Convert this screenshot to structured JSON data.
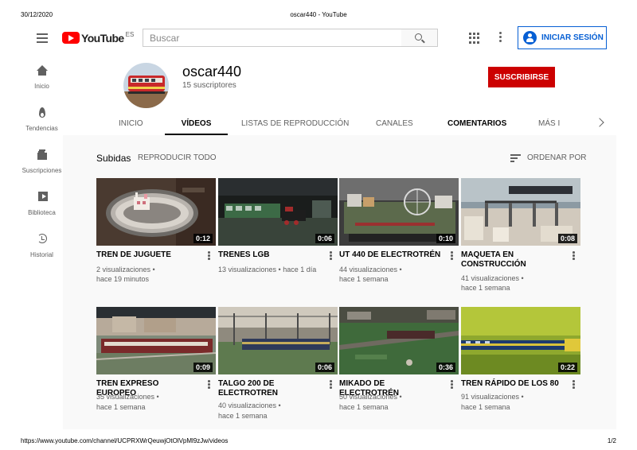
{
  "print": {
    "date": "30/12/2020",
    "title": "oscar440 - YouTube",
    "url": "https://www.youtube.com/channel/UCPRXWrQeuwjOtOlVpMl9zJw/videos",
    "page": "1/2"
  },
  "topbar": {
    "logo_text": "YouTube",
    "country_code": "ES",
    "search_placeholder": "Buscar",
    "signin_label": "INICIAR SESIÓN"
  },
  "sidebar": {
    "items": [
      {
        "label": "Inicio",
        "icon": "home-icon"
      },
      {
        "label": "Tendencias",
        "icon": "flame-icon"
      },
      {
        "label": "Suscripciones",
        "icon": "subscriptions-icon"
      },
      {
        "label": "Biblioteca",
        "icon": "library-icon"
      },
      {
        "label": "Historial",
        "icon": "history-icon"
      }
    ]
  },
  "channel": {
    "name": "oscar440",
    "subscribers": "15 suscriptores",
    "subscribe_label": "SUSCRIBIRSE",
    "tabs": [
      "INICIO",
      "VÍDEOS",
      "LISTAS DE REPRODUCCIÓN",
      "CANALES",
      "COMENTARIOS",
      "MÁS I"
    ],
    "active_tab": "VÍDEOS"
  },
  "section": {
    "title": "Subidas",
    "play_all": "REPRODUCIR TODO",
    "sort_label": "ORDENAR POR"
  },
  "videos": [
    {
      "title": "TREN DE JUGUETE",
      "views": "2 visualizaciones •",
      "age": "hace 19 minutos",
      "duration": "0:12"
    },
    {
      "title": "TRENES LGB",
      "views": "13 visualizaciones • hace 1 día",
      "age": "",
      "duration": "0:06"
    },
    {
      "title": "UT 440 DE ELECTROTRÉN",
      "views": "44 visualizaciones •",
      "age": "hace 1 semana",
      "duration": "0:10"
    },
    {
      "title": "MAQUETA EN CONSTRUCCIÓN",
      "views": "41 visualizaciones •",
      "age": "hace 1 semana",
      "duration": "0:08"
    },
    {
      "title": "TREN EXPRESO EUROPEO",
      "views": "35 visualizaciones •",
      "age": "hace 1 semana",
      "duration": "0:09"
    },
    {
      "title": "TALGO 200 DE ELECTROTREN",
      "views": "40 visualizaciones •",
      "age": "hace 1 semana",
      "duration": "0:06"
    },
    {
      "title": "MIKADO DE ELECTROTRÉN",
      "views": "50 visualizaciones •",
      "age": "hace 1 semana",
      "duration": "0:36"
    },
    {
      "title": "TREN RÁPIDO DE LOS 80",
      "views": "91 visualizaciones •",
      "age": "hace 1 semana",
      "duration": "0:22"
    }
  ],
  "colors": {
    "brand_red": "#ff0000",
    "subscribe_red": "#cc0000",
    "link_blue": "#065fd4"
  }
}
